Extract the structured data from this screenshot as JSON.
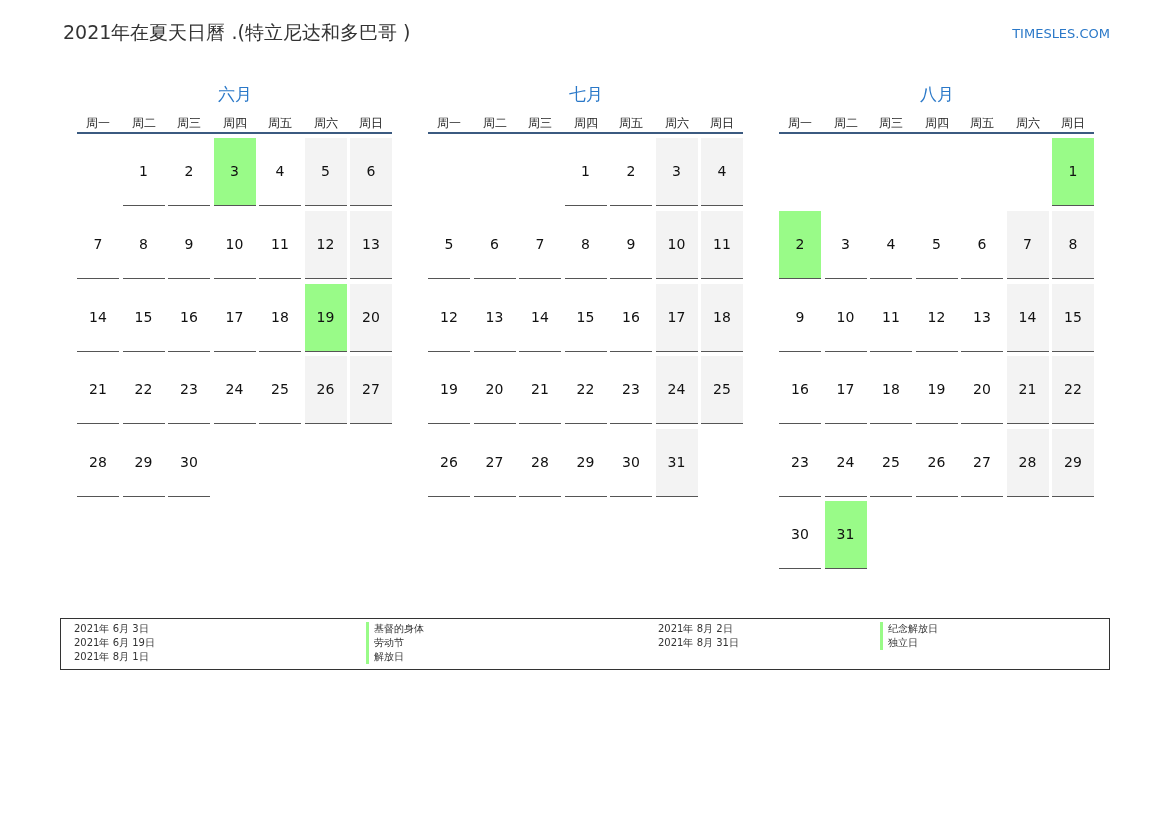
{
  "title": "2021年在夏天日曆 .(特立尼达和多巴哥 )",
  "site": "TIMESLES.COM",
  "months": [
    {
      "name": "六月",
      "weekdays": [
        "周一",
        "周二",
        "周三",
        "周四",
        "周五",
        "周六",
        "周日"
      ],
      "weeks": [
        [
          {
            "kind": "blank"
          },
          {
            "kind": "day",
            "day": "1",
            "holiday": false
          },
          {
            "kind": "day",
            "day": "2",
            "holiday": false
          },
          {
            "kind": "day",
            "day": "3",
            "holiday": true
          },
          {
            "kind": "day",
            "day": "4",
            "holiday": false
          },
          {
            "kind": "day",
            "day": "5",
            "holiday": false
          },
          {
            "kind": "day",
            "day": "6",
            "holiday": false
          }
        ],
        [
          {
            "kind": "day",
            "day": "7",
            "holiday": false
          },
          {
            "kind": "day",
            "day": "8",
            "holiday": false
          },
          {
            "kind": "day",
            "day": "9",
            "holiday": false
          },
          {
            "kind": "day",
            "day": "10",
            "holiday": false
          },
          {
            "kind": "day",
            "day": "11",
            "holiday": false
          },
          {
            "kind": "day",
            "day": "12",
            "holiday": false
          },
          {
            "kind": "day",
            "day": "13",
            "holiday": false
          }
        ],
        [
          {
            "kind": "day",
            "day": "14",
            "holiday": false
          },
          {
            "kind": "day",
            "day": "15",
            "holiday": false
          },
          {
            "kind": "day",
            "day": "16",
            "holiday": false
          },
          {
            "kind": "day",
            "day": "17",
            "holiday": false
          },
          {
            "kind": "day",
            "day": "18",
            "holiday": false
          },
          {
            "kind": "day",
            "day": "19",
            "holiday": true
          },
          {
            "kind": "day",
            "day": "20",
            "holiday": false
          }
        ],
        [
          {
            "kind": "day",
            "day": "21",
            "holiday": false
          },
          {
            "kind": "day",
            "day": "22",
            "holiday": false
          },
          {
            "kind": "day",
            "day": "23",
            "holiday": false
          },
          {
            "kind": "day",
            "day": "24",
            "holiday": false
          },
          {
            "kind": "day",
            "day": "25",
            "holiday": false
          },
          {
            "kind": "day",
            "day": "26",
            "holiday": false
          },
          {
            "kind": "day",
            "day": "27",
            "holiday": false
          }
        ],
        [
          {
            "kind": "day",
            "day": "28",
            "holiday": false
          },
          {
            "kind": "day",
            "day": "29",
            "holiday": false
          },
          {
            "kind": "day",
            "day": "30",
            "holiday": false
          }
        ]
      ]
    },
    {
      "name": "七月",
      "weekdays": [
        "周一",
        "周二",
        "周三",
        "周四",
        "周五",
        "周六",
        "周日"
      ],
      "weeks": [
        [
          {
            "kind": "blank"
          },
          {
            "kind": "blank"
          },
          {
            "kind": "blank"
          },
          {
            "kind": "day",
            "day": "1",
            "holiday": false
          },
          {
            "kind": "day",
            "day": "2",
            "holiday": false
          },
          {
            "kind": "day",
            "day": "3",
            "holiday": false
          },
          {
            "kind": "day",
            "day": "4",
            "holiday": false
          }
        ],
        [
          {
            "kind": "day",
            "day": "5",
            "holiday": false
          },
          {
            "kind": "day",
            "day": "6",
            "holiday": false
          },
          {
            "kind": "day",
            "day": "7",
            "holiday": false
          },
          {
            "kind": "day",
            "day": "8",
            "holiday": false
          },
          {
            "kind": "day",
            "day": "9",
            "holiday": false
          },
          {
            "kind": "day",
            "day": "10",
            "holiday": false
          },
          {
            "kind": "day",
            "day": "11",
            "holiday": false
          }
        ],
        [
          {
            "kind": "day",
            "day": "12",
            "holiday": false
          },
          {
            "kind": "day",
            "day": "13",
            "holiday": false
          },
          {
            "kind": "day",
            "day": "14",
            "holiday": false
          },
          {
            "kind": "day",
            "day": "15",
            "holiday": false
          },
          {
            "kind": "day",
            "day": "16",
            "holiday": false
          },
          {
            "kind": "day",
            "day": "17",
            "holiday": false
          },
          {
            "kind": "day",
            "day": "18",
            "holiday": false
          }
        ],
        [
          {
            "kind": "day",
            "day": "19",
            "holiday": false
          },
          {
            "kind": "day",
            "day": "20",
            "holiday": false
          },
          {
            "kind": "day",
            "day": "21",
            "holiday": false
          },
          {
            "kind": "day",
            "day": "22",
            "holiday": false
          },
          {
            "kind": "day",
            "day": "23",
            "holiday": false
          },
          {
            "kind": "day",
            "day": "24",
            "holiday": false
          },
          {
            "kind": "day",
            "day": "25",
            "holiday": false
          }
        ],
        [
          {
            "kind": "day",
            "day": "26",
            "holiday": false
          },
          {
            "kind": "day",
            "day": "27",
            "holiday": false
          },
          {
            "kind": "day",
            "day": "28",
            "holiday": false
          },
          {
            "kind": "day",
            "day": "29",
            "holiday": false
          },
          {
            "kind": "day",
            "day": "30",
            "holiday": false
          },
          {
            "kind": "day",
            "day": "31",
            "holiday": false
          }
        ]
      ]
    },
    {
      "name": "八月",
      "weekdays": [
        "周一",
        "周二",
        "周三",
        "周四",
        "周五",
        "周六",
        "周日"
      ],
      "weeks": [
        [
          {
            "kind": "blank"
          },
          {
            "kind": "blank"
          },
          {
            "kind": "blank"
          },
          {
            "kind": "blank"
          },
          {
            "kind": "blank"
          },
          {
            "kind": "blank"
          },
          {
            "kind": "day",
            "day": "1",
            "holiday": true
          }
        ],
        [
          {
            "kind": "day",
            "day": "2",
            "holiday": true
          },
          {
            "kind": "day",
            "day": "3",
            "holiday": false
          },
          {
            "kind": "day",
            "day": "4",
            "holiday": false
          },
          {
            "kind": "day",
            "day": "5",
            "holiday": false
          },
          {
            "kind": "day",
            "day": "6",
            "holiday": false
          },
          {
            "kind": "day",
            "day": "7",
            "holiday": false
          },
          {
            "kind": "day",
            "day": "8",
            "holiday": false
          }
        ],
        [
          {
            "kind": "day",
            "day": "9",
            "holiday": false
          },
          {
            "kind": "day",
            "day": "10",
            "holiday": false
          },
          {
            "kind": "day",
            "day": "11",
            "holiday": false
          },
          {
            "kind": "day",
            "day": "12",
            "holiday": false
          },
          {
            "kind": "day",
            "day": "13",
            "holiday": false
          },
          {
            "kind": "day",
            "day": "14",
            "holiday": false
          },
          {
            "kind": "day",
            "day": "15",
            "holiday": false
          }
        ],
        [
          {
            "kind": "day",
            "day": "16",
            "holiday": false
          },
          {
            "kind": "day",
            "day": "17",
            "holiday": false
          },
          {
            "kind": "day",
            "day": "18",
            "holiday": false
          },
          {
            "kind": "day",
            "day": "19",
            "holiday": false
          },
          {
            "kind": "day",
            "day": "20",
            "holiday": false
          },
          {
            "kind": "day",
            "day": "21",
            "holiday": false
          },
          {
            "kind": "day",
            "day": "22",
            "holiday": false
          }
        ],
        [
          {
            "kind": "day",
            "day": "23",
            "holiday": false
          },
          {
            "kind": "day",
            "day": "24",
            "holiday": false
          },
          {
            "kind": "day",
            "day": "25",
            "holiday": false
          },
          {
            "kind": "day",
            "day": "26",
            "holiday": false
          },
          {
            "kind": "day",
            "day": "27",
            "holiday": false
          },
          {
            "kind": "day",
            "day": "28",
            "holiday": false
          },
          {
            "kind": "day",
            "day": "29",
            "holiday": false
          }
        ],
        [
          {
            "kind": "day",
            "day": "30",
            "holiday": false
          },
          {
            "kind": "day",
            "day": "31",
            "holiday": true
          }
        ]
      ]
    }
  ],
  "legend": [
    [
      {
        "date": "2021年 6月 3日",
        "name": "基督的身体"
      },
      {
        "date": "2021年 6月 19日",
        "name": "劳动节"
      },
      {
        "date": "2021年 8月 1日",
        "name": "解放日"
      }
    ],
    [
      {
        "date": "2021年 8月 2日",
        "name": "纪念解放日"
      },
      {
        "date": "2021年 8月 31日",
        "name": "独立日"
      }
    ]
  ]
}
